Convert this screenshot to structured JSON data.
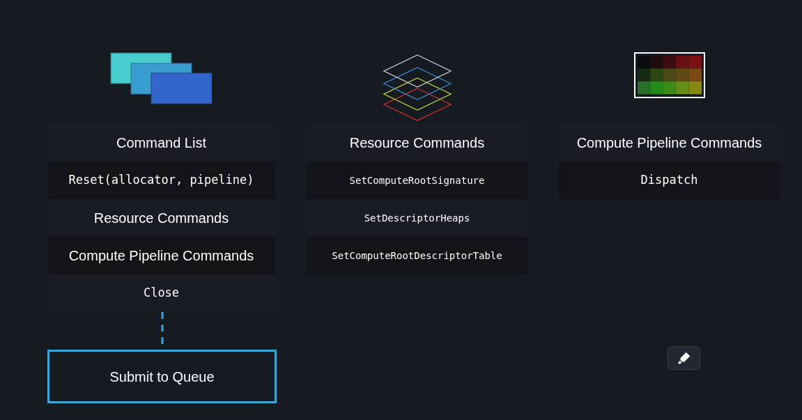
{
  "columns": [
    {
      "kind": "cards",
      "rows": [
        {
          "kind": "title",
          "text": "Command List"
        },
        {
          "kind": "code",
          "text": "Reset(allocator, pipeline)"
        },
        {
          "kind": "label",
          "text": "Resource Commands"
        },
        {
          "kind": "label",
          "text": "Compute Pipeline Commands"
        },
        {
          "kind": "code",
          "text": "Close"
        }
      ]
    },
    {
      "kind": "layers",
      "rows": [
        {
          "kind": "title",
          "text": "Resource Commands"
        },
        {
          "kind": "small-code",
          "text": "SetComputeRootSignature"
        },
        {
          "kind": "small-code",
          "text": "SetDescriptorHeaps"
        },
        {
          "kind": "small-code",
          "text": "SetComputeRootDescriptorTable"
        }
      ]
    },
    {
      "kind": "grid",
      "rows": [
        {
          "kind": "title",
          "text": "Compute Pipeline Commands"
        },
        {
          "kind": "code",
          "text": "Dispatch"
        }
      ]
    }
  ],
  "submit": {
    "label": "Submit to Queue"
  }
}
